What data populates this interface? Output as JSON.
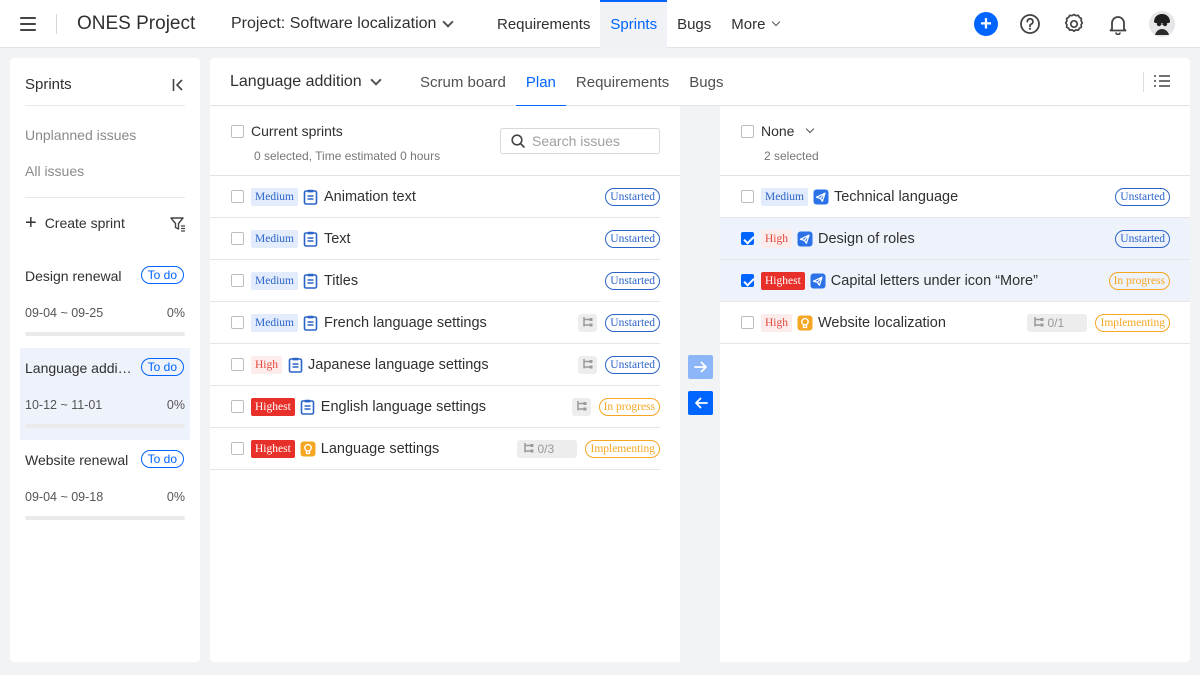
{
  "topbar": {
    "app_title": "ONES Project",
    "project_label": "Project: Software localization",
    "tabs": [
      {
        "label": "Requirements"
      },
      {
        "label": "Sprints"
      },
      {
        "label": "Bugs"
      },
      {
        "label": "More"
      }
    ],
    "active_tab": "Sprints",
    "accent_color": "#0064ff"
  },
  "sidebar": {
    "title": "Sprints",
    "links": [
      "Unplanned issues",
      "All issues"
    ],
    "create_label": "Create sprint",
    "sprints": [
      {
        "name": "Design renewal",
        "status": "To do",
        "dates": "09-04 ~ 09-25",
        "progress": "0%",
        "progress_value": 0
      },
      {
        "name": "Language addition",
        "status": "To do",
        "dates": "10-12 ~ 11-01",
        "progress": "0%",
        "progress_value": 0
      },
      {
        "name": "Website renewal",
        "status": "To do",
        "dates": "09-04 ~ 09-18",
        "progress": "0%",
        "progress_value": 0
      }
    ],
    "active_sprint": "Language addition"
  },
  "main": {
    "sprint_name": "Language addition",
    "tabs": [
      {
        "label": "Scrum board"
      },
      {
        "label": "Plan"
      },
      {
        "label": "Requirements"
      },
      {
        "label": "Bugs"
      }
    ],
    "active_tab": "Plan"
  },
  "left_panel": {
    "title": "Current sprints",
    "summary": "0 selected, Time estimated 0 hours",
    "search_placeholder": "Search issues",
    "rows": [
      {
        "priority": "Medium",
        "type": "requirement",
        "title": "Animation text",
        "status": "Unstarted",
        "sub": ""
      },
      {
        "priority": "Medium",
        "type": "requirement",
        "title": "Text",
        "status": "Unstarted",
        "sub": ""
      },
      {
        "priority": "Medium",
        "type": "requirement",
        "title": "Titles",
        "status": "Unstarted",
        "sub": ""
      },
      {
        "priority": "Medium",
        "type": "requirement",
        "title": "French language settings",
        "status": "Unstarted",
        "sub": "icon"
      },
      {
        "priority": "High",
        "type": "requirement",
        "title": "Japanese language settings",
        "status": "Unstarted",
        "sub": "icon"
      },
      {
        "priority": "Highest",
        "type": "requirement",
        "title": "English language settings",
        "status": "In progress",
        "sub": "icon"
      },
      {
        "priority": "Highest",
        "type": "feature",
        "title": "Language settings",
        "status": "Implementing",
        "sub": "0/3"
      }
    ]
  },
  "right_panel": {
    "title": "None",
    "summary": "2 selected",
    "rows": [
      {
        "priority": "Medium",
        "type": "task",
        "title": "Technical language",
        "status": "Unstarted",
        "sub": "",
        "checked": false
      },
      {
        "priority": "High",
        "type": "task",
        "title": "Design of roles",
        "status": "Unstarted",
        "sub": "",
        "checked": true
      },
      {
        "priority": "Highest",
        "type": "task",
        "title": "Capital letters under icon “More”",
        "status": "In progress",
        "sub": "",
        "checked": true
      },
      {
        "priority": "High",
        "type": "feature",
        "title": "Website localization",
        "status": "Implementing",
        "sub": "0/1",
        "checked": false
      }
    ]
  },
  "icons": {
    "menu": "hamburger-icon",
    "add": "plus-circle-icon",
    "help": "question-icon",
    "settings": "gear-icon",
    "notifications": "bell-icon",
    "collapse": "collapse-left-icon",
    "filter": "filter-icon",
    "search": "search-icon",
    "list_view": "list-view-icon",
    "move_right": "arrow-right-icon",
    "move_left": "arrow-left-icon"
  },
  "colors": {
    "medium": "#2b64c8",
    "high": "#e5483c",
    "highest": "#e8302a",
    "in_progress": "#f5a623"
  }
}
